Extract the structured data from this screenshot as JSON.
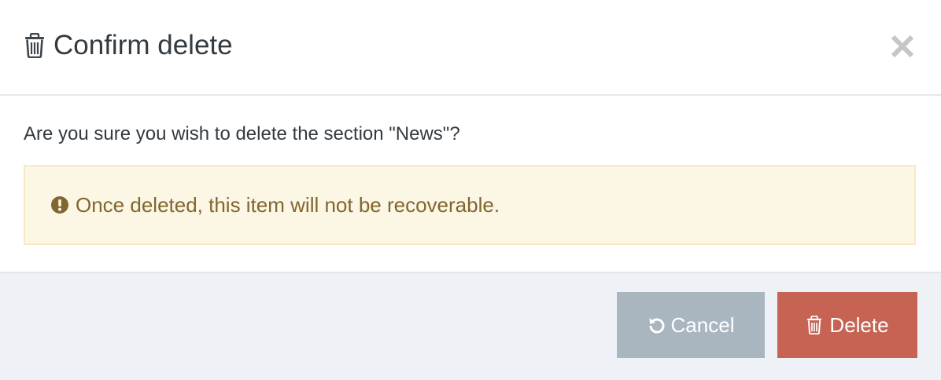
{
  "dialog": {
    "title": "Confirm delete",
    "title_icon": "trash-icon",
    "close_icon": "close-icon"
  },
  "body": {
    "question": "Are you sure you wish to delete the section \"News\"?",
    "warning": {
      "icon": "exclamation-circle-icon",
      "text": "Once deleted, this item will not be recoverable."
    }
  },
  "footer": {
    "cancel": {
      "label": "Cancel",
      "icon": "undo-icon"
    },
    "delete": {
      "label": "Delete",
      "icon": "trash-icon"
    }
  },
  "colors": {
    "warning_bg": "#fcf6e5",
    "warning_text": "#80662f",
    "cancel_bg": "#a9b6c0",
    "delete_bg": "#c66352",
    "footer_bg": "#eef1f6"
  }
}
